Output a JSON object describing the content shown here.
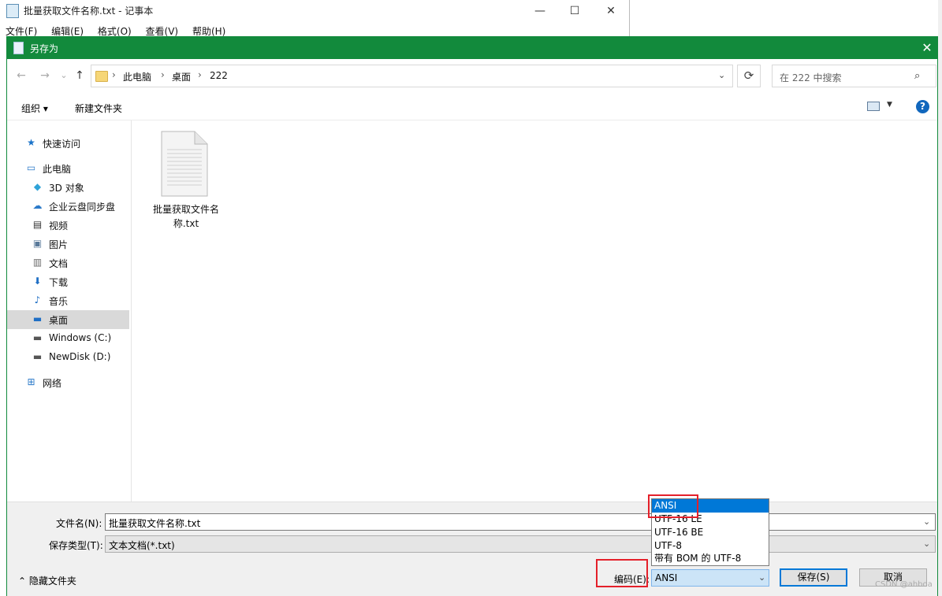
{
  "notepad": {
    "title": "批量获取文件名称.txt - 记事本",
    "menu": [
      "文件(F)",
      "编辑(E)",
      "格式(O)",
      "查看(V)",
      "帮助(H)"
    ],
    "controls": {
      "minimize": "—",
      "maximize": "☐",
      "close": "✕"
    }
  },
  "dialog": {
    "title": "另存为",
    "close": "✕",
    "nav": {
      "back": "←",
      "forward": "→",
      "recent": "⌄",
      "up": "↑"
    },
    "breadcrumb": [
      "此电脑",
      "桌面",
      "222"
    ],
    "crumb_sep": "›",
    "address_dropdown": "⌄",
    "refresh": "⟳",
    "search_placeholder": "在 222 中搜索",
    "search_glyph": "⌕",
    "toolbar": {
      "organize": "组织 ▾",
      "new_folder": "新建文件夹",
      "view_drop": "▼",
      "help": "?"
    },
    "sidebar": [
      {
        "label": "快速访问",
        "icon": "quick-access-icon",
        "glyph": "★",
        "color": "#1a73c9",
        "indent": false
      },
      {
        "label": "此电脑",
        "icon": "computer-icon",
        "glyph": "▭",
        "color": "#2b7ac9",
        "indent": false
      },
      {
        "label": "3D 对象",
        "icon": "3d-objects-icon",
        "glyph": "◆",
        "color": "#2fa3d8",
        "indent": true
      },
      {
        "label": "企业云盘同步盘",
        "icon": "cloud-icon",
        "glyph": "☁",
        "color": "#2b7ac9",
        "indent": true
      },
      {
        "label": "视频",
        "icon": "video-icon",
        "glyph": "▤",
        "color": "#333333",
        "indent": true
      },
      {
        "label": "图片",
        "icon": "pictures-icon",
        "glyph": "▣",
        "color": "#5a7a9a",
        "indent": true
      },
      {
        "label": "文档",
        "icon": "documents-icon",
        "glyph": "▥",
        "color": "#6a6a6a",
        "indent": true
      },
      {
        "label": "下载",
        "icon": "downloads-icon",
        "glyph": "⬇",
        "color": "#1f6fc5",
        "indent": true
      },
      {
        "label": "音乐",
        "icon": "music-icon",
        "glyph": "♪",
        "color": "#1f6fc5",
        "indent": true
      },
      {
        "label": "桌面",
        "icon": "desktop-icon",
        "glyph": "▬",
        "color": "#1f6fc5",
        "indent": true,
        "selected": true
      },
      {
        "label": "Windows (C:)",
        "icon": "drive-c-icon",
        "glyph": "▬",
        "color": "#555555",
        "indent": true
      },
      {
        "label": "NewDisk (D:)",
        "icon": "drive-d-icon",
        "glyph": "▬",
        "color": "#555555",
        "indent": true
      },
      {
        "label": "网络",
        "icon": "network-icon",
        "glyph": "⊞",
        "color": "#2b7ac9",
        "indent": false
      }
    ],
    "file": {
      "name_line1": "批量获取文件名",
      "name_line2": "称.txt"
    },
    "filename_label": "文件名(N):",
    "filename_value": "批量获取文件名称.txt",
    "type_label": "保存类型(T):",
    "type_value": "文本文档(*.txt)",
    "combo_drop": "⌄",
    "hide_folders": "⌃ 隐藏文件夹",
    "encoding_label": "编码(E):",
    "encoding_value": "ANSI",
    "encoding_options": [
      "ANSI",
      "UTF-16 LE",
      "UTF-16 BE",
      "UTF-8",
      "带有 BOM 的 UTF-8"
    ],
    "save_button": "保存(S)",
    "cancel_button": "取消"
  },
  "watermark": "CSDN @ahboa",
  "colors": {
    "titlebar": "#128a3c",
    "highlight": "#0078d7",
    "annotation": "#e4202a"
  }
}
